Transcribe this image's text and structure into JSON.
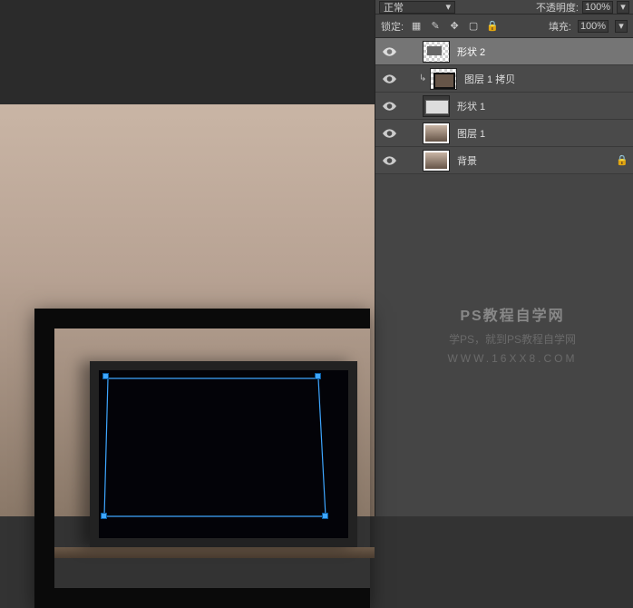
{
  "toolbar": {
    "blend_mode": "正常",
    "opacity_label": "不透明度:",
    "opacity_value": "100%",
    "lock_label": "锁定:",
    "fill_label": "填充:",
    "fill_value": "100%"
  },
  "layers": [
    {
      "name": "形状 2",
      "selected": true,
      "clip": false,
      "thumb": "shape2",
      "locked": false
    },
    {
      "name": "图层 1 拷贝",
      "selected": false,
      "clip": true,
      "thumb": "copy1",
      "locked": false
    },
    {
      "name": "形状 1",
      "selected": false,
      "clip": false,
      "thumb": "shape1",
      "locked": false
    },
    {
      "name": "图层 1",
      "selected": false,
      "clip": false,
      "thumb": "lyr1",
      "locked": false
    },
    {
      "name": "背景",
      "selected": false,
      "clip": false,
      "thumb": "bg",
      "locked": true
    }
  ],
  "watermark": {
    "line1": "PS教程自学网",
    "line2": "学PS，就到PS教程自学网",
    "line3": "WWW.16XX8.COM"
  },
  "icons": {
    "lock_transparent": "▦",
    "lock_brush": "✎",
    "lock_move": "✥",
    "lock_crop": "▢",
    "lock_all": "🔒",
    "dropdown": "▾",
    "clip": "↳",
    "locked_layer": "🔒"
  }
}
